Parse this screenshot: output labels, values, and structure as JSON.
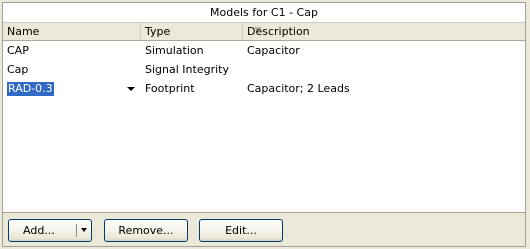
{
  "panel": {
    "title": "Models for C1 - Cap"
  },
  "columns": {
    "name": "Name",
    "type": "Type",
    "description": "Description",
    "sort_icon": "sort-indicator-icon"
  },
  "rows": [
    {
      "name": "CAP",
      "type": "Simulation",
      "description": "Capacitor"
    },
    {
      "name": "Cap",
      "type": "Signal Integrity",
      "description": ""
    },
    {
      "name": "RAD-0.3",
      "type": "Footprint",
      "description": "Capacitor; 2 Leads",
      "selected": true
    }
  ],
  "buttons": {
    "add": "Add...",
    "remove": "Remove...",
    "edit": "Edit..."
  },
  "colors": {
    "selection": "#316ac5",
    "background": "#ece9d8"
  }
}
